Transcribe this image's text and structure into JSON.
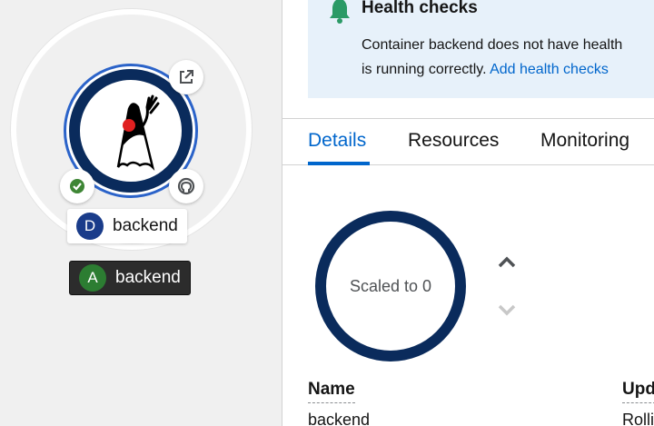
{
  "topology": {
    "deployment_badge_letter": "D",
    "deployment_name": "backend",
    "application_badge_letter": "A",
    "application_name": "backend",
    "icons": {
      "link": "external-link-icon",
      "status": "check-circle-icon",
      "git": "github-icon",
      "runtime": "java-duke-icon"
    },
    "colors": {
      "ring": "#0a2b5c",
      "selection": "#2b63c9",
      "status_ok": "#3e8635"
    }
  },
  "panel": {
    "alert": {
      "icon": "bell-icon",
      "title": "Health checks",
      "body_line1": "Container backend does not have health",
      "body_line2": "is running correctly.",
      "link_text": "Add health checks"
    },
    "tabs": [
      {
        "label": "Details",
        "active": true
      },
      {
        "label": "Resources",
        "active": false
      },
      {
        "label": "Monitoring",
        "active": false
      }
    ],
    "pod": {
      "label": "Scaled to 0",
      "scale_up_icon": "chevron-up-icon",
      "scale_down_icon": "chevron-down-icon"
    },
    "details": {
      "name_label": "Name",
      "name_value": "backend",
      "update_label": "Upd",
      "update_value": "Rolli"
    }
  }
}
